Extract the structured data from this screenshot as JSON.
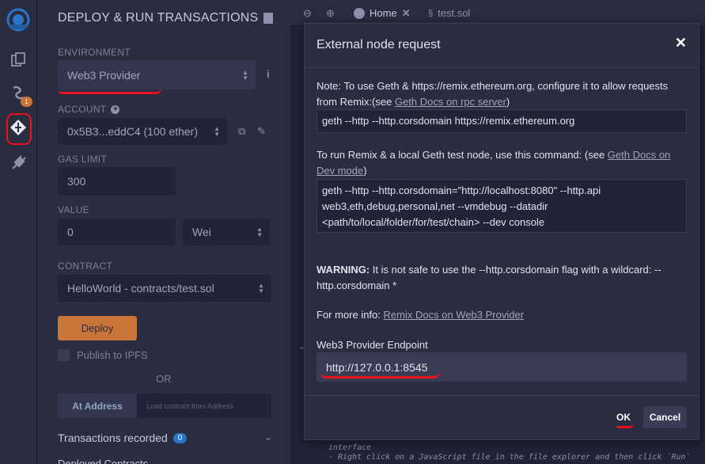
{
  "rail": {
    "icons": [
      "remix-logo-icon",
      "file-explorer-icon",
      "compiler-icon",
      "deploy-run-icon",
      "plugin-manager-icon"
    ],
    "compiler_badge": "1"
  },
  "panel": {
    "title": "DEPLOY & RUN TRANSACTIONS",
    "environment_label": "ENVIRONMENT",
    "environment_value": "Web3 Provider",
    "account_label": "ACCOUNT",
    "account_value": "0x5B3...eddC4 (100 ether)",
    "gas_limit_label": "GAS LIMIT",
    "gas_limit_value": "300",
    "value_label": "VALUE",
    "value_amount": "0",
    "value_unit": "Wei",
    "contract_label": "CONTRACT",
    "contract_value": "HelloWorld - contracts/test.sol",
    "deploy_button": "Deploy",
    "publish_ipfs": "Publish to IPFS",
    "or_text": "OR",
    "at_address_button": "At Address",
    "load_contract_placeholder": "Load contract from Address",
    "transactions_recorded": "Transactions recorded",
    "transactions_count": "0",
    "cut_off_heading": "Deployed Contracts"
  },
  "topbar": {
    "tabs": [
      {
        "label": "Home"
      },
      {
        "label": "test.sol"
      }
    ]
  },
  "editor": {
    "line_interface": "interface",
    "line_right_click": "- Right click on a JavaScript file in the file explorer and then click `Run`"
  },
  "modal": {
    "title": "External node request",
    "note_text": "Note: To use Geth & https://remix.ethereum.org, configure it to allow requests from Remix:(see ",
    "note_link": "Geth Docs on rpc server",
    "note_close": ")",
    "geth_command": "geth --http --http.corsdomain https://remix.ethereum.org",
    "run_local_text": "To run Remix & a local Geth test node, use this command: (see ",
    "run_local_link": "Geth Docs on Dev mode",
    "run_local_close": ")",
    "dev_command": "geth --http --http.corsdomain=\"http://localhost:8080\" --http.api web3,eth,debug,personal,net --vmdebug --datadir <path/to/local/folder/for/test/chain> --dev console",
    "warning_label": "WARNING:",
    "warning_text": " It is not safe to use the --http.corsdomain flag with a wildcard: --http.corsdomain *",
    "more_info_text": "For more info: ",
    "more_info_link": "Remix Docs on Web3 Provider",
    "endpoint_label": "Web3 Provider Endpoint",
    "endpoint_value": "http://127.0.0.1:8545",
    "ok_button": "OK",
    "cancel_button": "Cancel"
  },
  "colors": {
    "annotation_red": "#e8111c",
    "deploy_orange": "#c97539",
    "background": "#222336",
    "panel": "#2a2c3f"
  }
}
